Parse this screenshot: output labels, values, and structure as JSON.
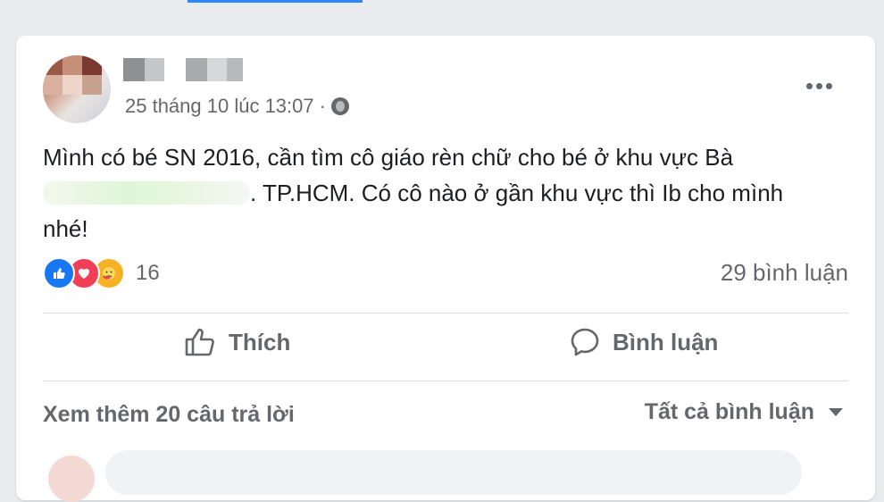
{
  "post": {
    "timestamp": "25 tháng 10 lúc 13:07",
    "separator": "·",
    "privacy_icon": "globe-icon",
    "more_icon": "more-options-icon",
    "text_line1": "Mình có bé SN 2016, cần tìm cô giáo rèn chữ cho bé ở khu vực Bà",
    "text_line2_after_blur": ". TP.HCM. Có cô nào ở gần khu vực thì Ib cho mình",
    "text_line3": "nhé!"
  },
  "stats": {
    "reaction_icons": [
      "like-icon",
      "love-icon",
      "care-icon"
    ],
    "reaction_count": "16",
    "comment_count": "29 bình luận"
  },
  "actions": {
    "like_label": "Thích",
    "comment_label": "Bình luận"
  },
  "comments": {
    "see_more": "Xem thêm 20 câu trả lời",
    "filter_label": "Tất cả bình luận"
  },
  "colors": {
    "accent": "#2d88ff",
    "like": "#1877f2",
    "love": "#f33e58",
    "care": "#f7b125",
    "secondary_text": "#65676b"
  }
}
